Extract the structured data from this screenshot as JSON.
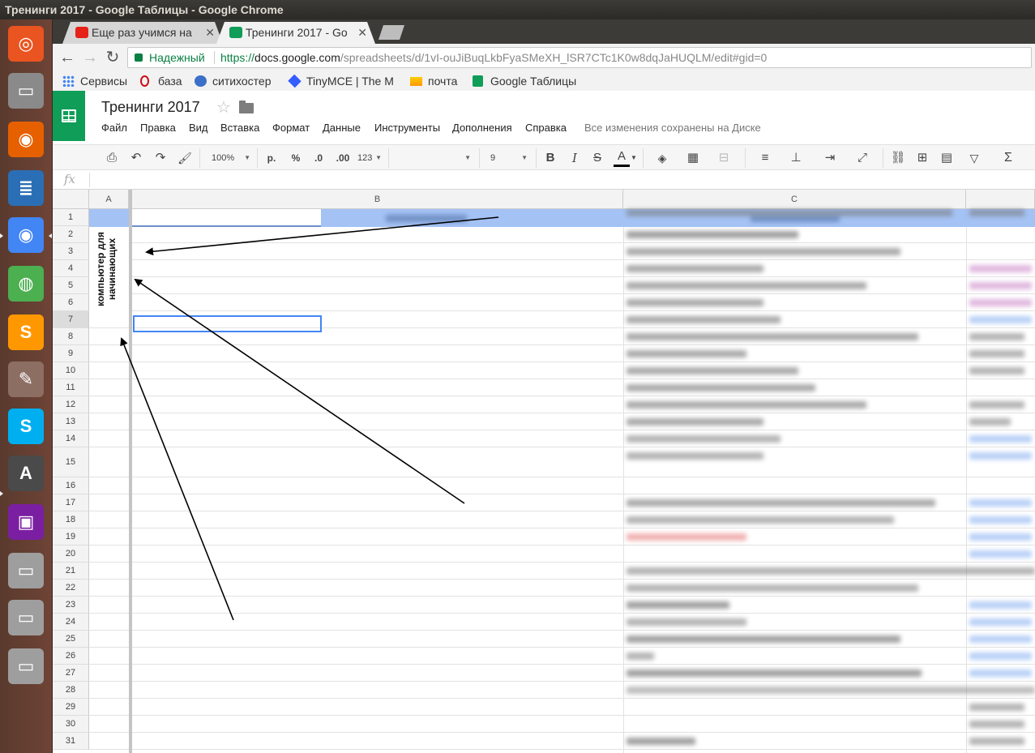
{
  "window": {
    "title": "Тренинги 2017 - Google Таблицы - Google Chrome"
  },
  "launcher": {
    "items": [
      {
        "name": "ubuntu-dash-icon",
        "color": "#e95420"
      },
      {
        "name": "files-icon",
        "color": "#8a8a8a"
      },
      {
        "name": "firefox-icon",
        "color": "#e66000"
      },
      {
        "name": "writer-icon",
        "color": "#2a6fb5"
      },
      {
        "name": "chrome-icon",
        "color": "#4285f4"
      },
      {
        "name": "globe-icon",
        "color": "#4caf50"
      },
      {
        "name": "sublime-icon",
        "color": "#ff9800"
      },
      {
        "name": "paint-icon",
        "color": "#8d6e63"
      },
      {
        "name": "skype-icon",
        "color": "#00aff0"
      },
      {
        "name": "software-updater-icon",
        "color": "#4a4a4a"
      },
      {
        "name": "workspace-switcher-icon",
        "color": "#7b1fa2"
      },
      {
        "name": "disk-drive-icon",
        "color": "#9e9e9e"
      },
      {
        "name": "disk-drive-icon",
        "color": "#9e9e9e"
      },
      {
        "name": "disk-drive-icon",
        "color": "#9e9e9e"
      }
    ]
  },
  "tabs": [
    {
      "label": "Еще раз учимся на",
      "favicon_color": "#e62117",
      "active": false
    },
    {
      "label": "Тренинги 2017 - Go",
      "favicon_color": "#0f9d58",
      "active": true
    }
  ],
  "omnibox": {
    "secure_label": "Надежный",
    "url_scheme": "https://",
    "url_host": "docs.google.com",
    "url_path": "/spreadsheets/d/1vI-ouJiBuqLkbFyaSMeXH_lSR7CTc1K0w8dqJaHUQLM/edit#gid=0"
  },
  "bookmarks": [
    {
      "label": "Сервисы",
      "icon": "apps-icon"
    },
    {
      "label": "база",
      "icon": "opera-icon"
    },
    {
      "label": "ситихостер",
      "icon": "hosting-icon"
    },
    {
      "label": "TinyMCE | The M",
      "icon": "tinymce-icon"
    },
    {
      "label": "почта",
      "icon": "mail-icon"
    },
    {
      "label": "Google Таблицы",
      "icon": "sheets-icon"
    }
  ],
  "sheets": {
    "title": "Тренинги 2017",
    "menu": [
      "Файл",
      "Правка",
      "Вид",
      "Вставка",
      "Формат",
      "Данные",
      "Инструменты",
      "Дополнения",
      "Справка"
    ],
    "saved_status": "Все изменения сохранены на Диске"
  },
  "toolbar": {
    "zoom": "100%",
    "currency": "р.",
    "percent": "%",
    "dec_decrease": ".0",
    "dec_increase": ".00",
    "format_more": "123",
    "font_size": "9",
    "bold": "B",
    "italic": "I",
    "strike": "S",
    "text_color": "A",
    "sum": "Σ"
  },
  "formula_bar": {
    "fx": "fx",
    "value": ""
  },
  "grid": {
    "columns": [
      "A",
      "B",
      "C"
    ],
    "rows": [
      "1",
      "2",
      "3",
      "4",
      "5",
      "6",
      "7",
      "8",
      "9",
      "10",
      "11",
      "12",
      "13",
      "14",
      "15",
      "16",
      "17",
      "18",
      "19",
      "20",
      "21",
      "22",
      "23",
      "24",
      "25",
      "26",
      "27",
      "28",
      "29",
      "30",
      "31"
    ],
    "selected_row": "7",
    "merged_a_text": "компьютер для начинающих"
  },
  "colors": {
    "sheets_green": "#0f9d58",
    "header_row_fill": "#a4c2f4",
    "selection": "#4285f4",
    "secure_green": "#0b8043"
  }
}
